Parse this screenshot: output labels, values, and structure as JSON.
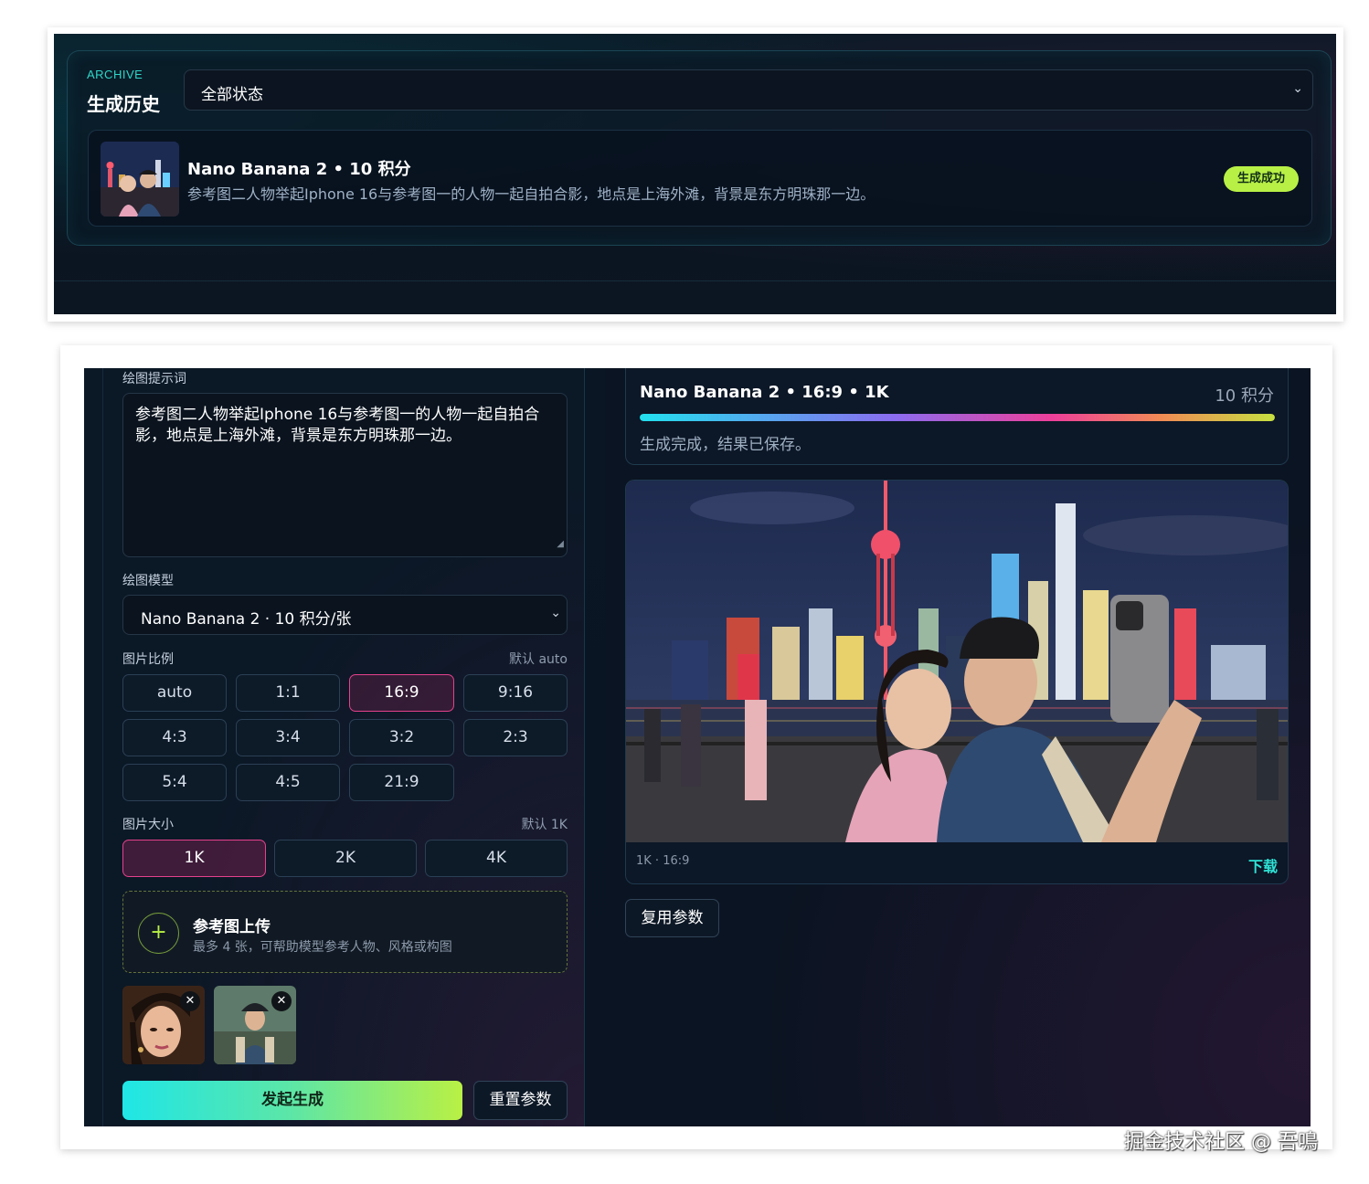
{
  "archive": {
    "eyebrow": "ARCHIVE",
    "title": "生成历史",
    "status_filter": "全部状态",
    "items": [
      {
        "title": "Nano Banana 2 • 10 积分",
        "description": "参考图二人物举起Iphone 16与参考图一的人物一起自拍合影，地点是上海外滩，背景是东方明珠那一边。",
        "status": "生成成功"
      }
    ]
  },
  "form": {
    "prompt_label": "绘图提示词",
    "prompt_value": "参考图二人物举起Iphone 16与参考图一的人物一起自拍合影，地点是上海外滩，背景是东方明珠那一边。",
    "model_label": "绘图模型",
    "model_value": "Nano Banana 2 · 10 积分/张",
    "ratio_label": "图片比例",
    "ratio_default": "默认 auto",
    "ratios": [
      "auto",
      "1:1",
      "16:9",
      "9:16",
      "4:3",
      "3:4",
      "3:2",
      "2:3",
      "5:4",
      "4:5",
      "21:9"
    ],
    "ratio_selected": "16:9",
    "size_label": "图片大小",
    "size_default": "默认 1K",
    "sizes": [
      "1K",
      "2K",
      "4K"
    ],
    "size_selected": "1K",
    "upload_title": "参考图上传",
    "upload_hint": "最多 4 张，可帮助模型参考人物、风格或构图",
    "ref_count": 2,
    "generate_label": "发起生成",
    "reset_label": "重置参数"
  },
  "result": {
    "title": "Nano Banana 2 • 16:9 • 1K",
    "credits": "10 积分",
    "progress": 1.0,
    "message": "生成完成，结果已保存。",
    "meta": "1K · 16:9",
    "download_label": "下载",
    "reuse_label": "复用参数"
  },
  "watermark": "掘金技术社区 @ 吾鳴",
  "colors": {
    "accent_cyan": "#2ee3d6",
    "accent_pink": "#e5418c",
    "accent_lime": "#b8f046",
    "panel_bg": "#0b1826"
  }
}
